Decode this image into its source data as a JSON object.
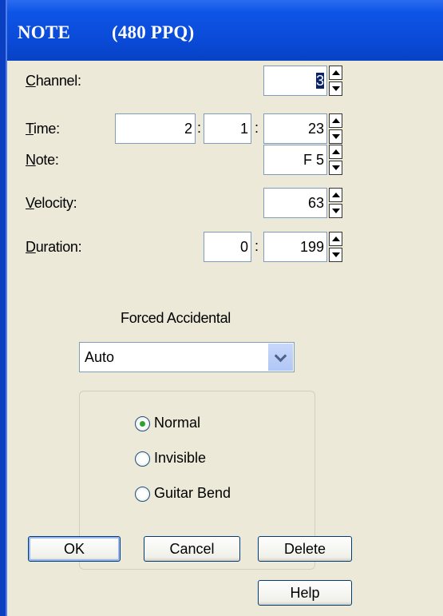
{
  "title": {
    "name": "NOTE",
    "ppq": "(480 PPQ)"
  },
  "fields": {
    "channel": {
      "label_key": "C",
      "label_rest": "hannel:",
      "value": "3"
    },
    "time": {
      "label_key": "T",
      "label_rest": "ime:",
      "bar": "2",
      "beat": "1",
      "tick": "23",
      "sep": ":"
    },
    "note": {
      "label_key": "N",
      "label_rest": "ote:",
      "value": "F 5"
    },
    "velocity": {
      "label_key": "V",
      "label_rest": "elocity:",
      "value": "63"
    },
    "duration": {
      "label_key": "D",
      "label_rest": "uration:",
      "beats": "0",
      "ticks": "199",
      "sep": ":"
    }
  },
  "accidental": {
    "label": "Forced Accidental",
    "selected": "Auto"
  },
  "display": {
    "options": [
      {
        "label": "Normal",
        "checked": true
      },
      {
        "label": "Invisible",
        "checked": false
      },
      {
        "label": "Guitar Bend",
        "checked": false
      }
    ]
  },
  "buttons": {
    "ok": "OK",
    "cancel": "Cancel",
    "delete": "Delete",
    "help": "Help"
  },
  "colors": {
    "titlebar": "#0a49d6",
    "dialog": "#ece9d8",
    "radio_on": "#2fa12f"
  }
}
